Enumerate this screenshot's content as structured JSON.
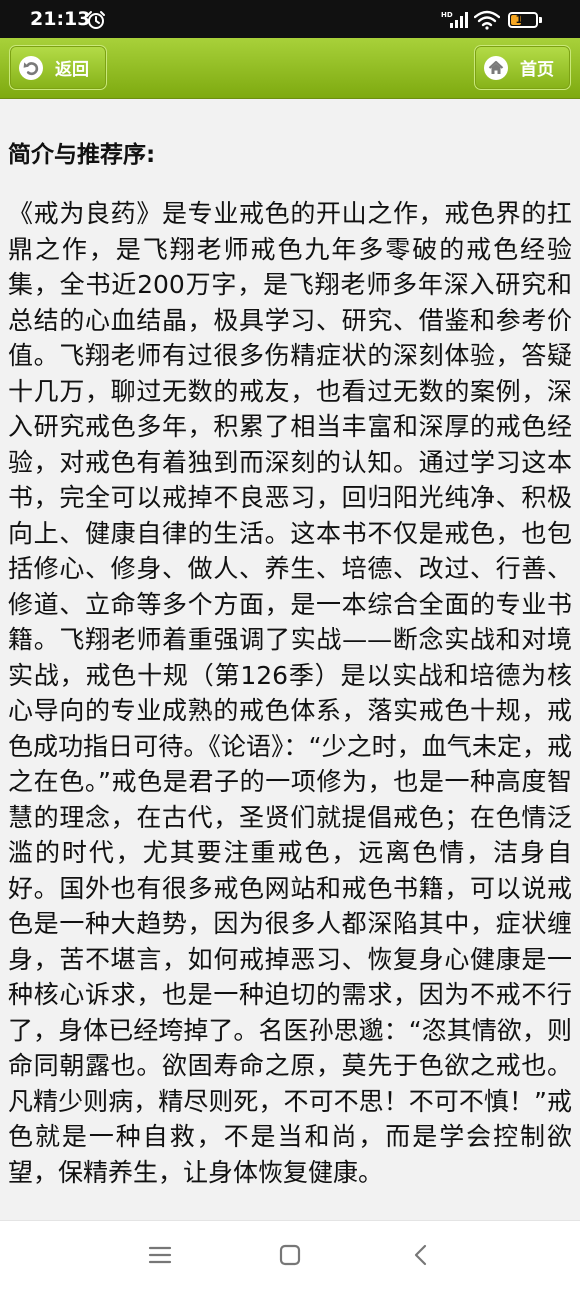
{
  "status_bar": {
    "time": "21:13",
    "network_label": "HD",
    "battery_level": "19",
    "battery_color": "#f5a623"
  },
  "header": {
    "back_label": "返回",
    "home_label": "首页",
    "back_icon": "undo-arrow-icon",
    "home_icon": "house-icon",
    "accent_color": "#8fbc1c"
  },
  "content": {
    "section_title": "简介与推荐序:",
    "body": "《戒为良药》是专业戒色的开山之作，戒色界的扛鼎之作，是飞翔老师戒色九年多零破的戒色经验集，全书近200万字，是飞翔老师多年深入研究和总结的心血结晶，极具学习、研究、借鉴和参考价值。飞翔老师有过很多伤精症状的深刻体验，答疑十几万，聊过无数的戒友，也看过无数的案例，深入研究戒色多年，积累了相当丰富和深厚的戒色经验，对戒色有着独到而深刻的认知。通过学习这本书，完全可以戒掉不良恶习，回归阳光纯净、积极向上、健康自律的生活。这本书不仅是戒色，也包括修心、修身、做人、养生、培德、改过、行善、修道、立命等多个方面，是一本综合全面的专业书籍。飞翔老师着重强调了实战——断念实战和对境实战，戒色十规（第126季）是以实战和培德为核心导向的专业成熟的戒色体系，落实戒色十规，戒色成功指日可待。《论语》：“少之时，血气未定，戒之在色。”戒色是君子的一项修为，也是一种高度智慧的理念，在古代，圣贤们就提倡戒色；在色情泛滥的时代，尤其要注重戒色，远离色情，洁身自好。国外也有很多戒色网站和戒色书籍，可以说戒色是一种大趋势，因为很多人都深陷其中，症状缠身，苦不堪言，如何戒掉恶习、恢复身心健康是一种核心诉求，也是一种迫切的需求，因为不戒不行了，身体已经垮掉了。名医孙思邈：“恣其情欲，则命同朝露也。欲固寿命之原，莫先于色欲之戒也。凡精少则病，精尽则死，不可不思！不可不慎！”戒色就是一种自救，不是当和尚，而是学会控制欲望，保精养生，让身体恢复健康。"
  },
  "system_nav": {
    "menu_icon": "menu-icon",
    "home_icon": "square-home-icon",
    "back_icon": "back-chevron-icon"
  }
}
